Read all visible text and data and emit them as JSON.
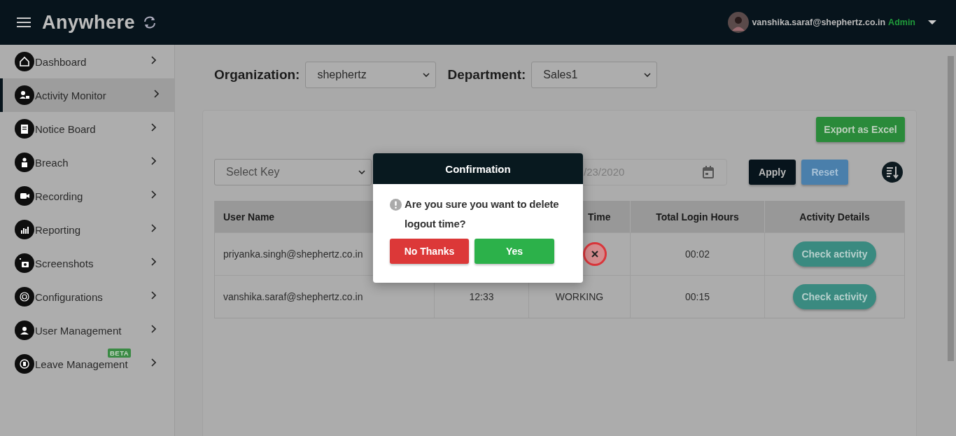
{
  "header": {
    "brand": "Anywhere",
    "user": {
      "email": "vanshika.saraf@shephertz.co.in",
      "role": "Admin"
    }
  },
  "sidebar": {
    "items": [
      {
        "label": "Dashboard",
        "selected": false
      },
      {
        "label": "Activity Monitor",
        "selected": true
      },
      {
        "label": "Notice Board",
        "selected": false
      },
      {
        "label": "Breach",
        "selected": false
      },
      {
        "label": "Recording",
        "selected": false
      },
      {
        "label": "Reporting",
        "selected": false
      },
      {
        "label": "Screenshots",
        "selected": false
      },
      {
        "label": "Configurations",
        "selected": false
      },
      {
        "label": "User Management",
        "selected": false
      },
      {
        "label": "Leave Management",
        "selected": false,
        "badge": "BETA"
      }
    ]
  },
  "filters": {
    "organization": {
      "label": "Organization:",
      "value": "shephertz"
    },
    "department": {
      "label": "Department:",
      "value": "Sales1"
    }
  },
  "card": {
    "export_button": "Export as Excel",
    "key_select": "Select Key",
    "end_date": "/23/2020",
    "apply_button": "Apply",
    "reset_button": "Reset",
    "table": {
      "columns": [
        {
          "label": "User Name"
        },
        {},
        {
          "label": "Time"
        },
        {
          "label": "Total Login Hours"
        },
        {
          "label": "Activity Details"
        }
      ],
      "rows": [
        {
          "user_name": "priyanka.singh@shephertz.co.in",
          "delete_button": true,
          "total_login_hours": "00:02",
          "action": "Check activity"
        },
        {
          "user_name": "vanshika.saraf@shephertz.co.in",
          "column_2": "12:33",
          "column_3": "WORKING",
          "delete_button": false,
          "total_login_hours": "00:15",
          "action": "Check activity"
        }
      ]
    }
  },
  "modal": {
    "title": "Confirmation",
    "message": "Are you sure you want to delete logout time?",
    "buttons": [
      {
        "label": "No Thanks",
        "kind": "cancel"
      },
      {
        "label": "Yes",
        "kind": "confirm"
      }
    ]
  }
}
